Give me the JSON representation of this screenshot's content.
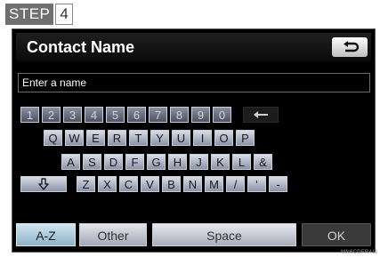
{
  "step": {
    "label": "STEP",
    "number": "4"
  },
  "screen": {
    "title": "Contact Name",
    "back_icon": "return-arrow-icon",
    "input_placeholder": "Enter a name"
  },
  "keyboard": {
    "row1": [
      "1",
      "2",
      "3",
      "4",
      "5",
      "6",
      "7",
      "8",
      "9",
      "0"
    ],
    "backspace_icon": "left-arrow-icon",
    "row2": [
      "Q",
      "W",
      "E",
      "R",
      "T",
      "Y",
      "U",
      "I",
      "O",
      "P"
    ],
    "row3": [
      "A",
      "S",
      "D",
      "F",
      "G",
      "H",
      "J",
      "K",
      "L",
      "&"
    ],
    "shift_icon": "shift-arrow-icon",
    "row4": [
      "Z",
      "X",
      "C",
      "V",
      "B",
      "N",
      "M",
      "/",
      "'",
      "-"
    ]
  },
  "bottom": {
    "az": "A-Z",
    "other": "Other",
    "space": "Space",
    "ok": "OK"
  },
  "watermark": "MN6CDFR411"
}
